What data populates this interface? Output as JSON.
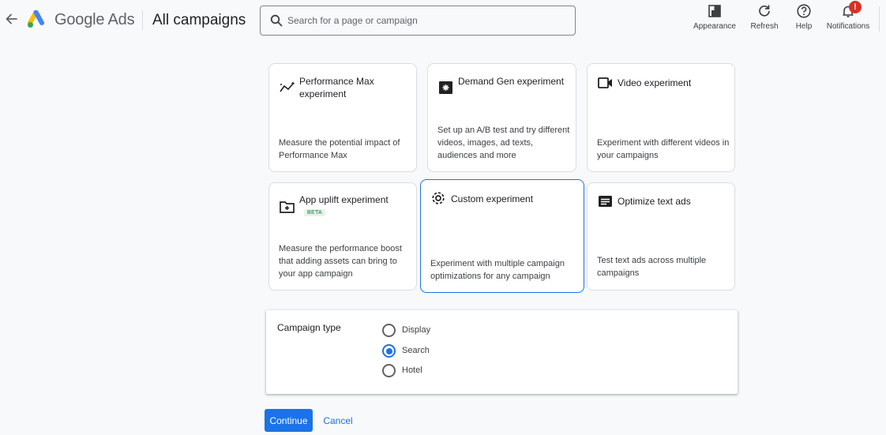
{
  "header": {
    "brand": "Google Ads",
    "title": "All campaigns",
    "search_placeholder": "Search for a page or campaign",
    "actions": [
      {
        "label": "Appearance",
        "icon": "appearance-icon"
      },
      {
        "label": "Refresh",
        "icon": "refresh-icon"
      },
      {
        "label": "Help",
        "icon": "help-icon"
      },
      {
        "label": "Notifications",
        "icon": "bell-icon",
        "badge": "!"
      }
    ]
  },
  "cards": [
    {
      "title": "Performance Max experiment",
      "description": "Measure the potential impact of Performance Max",
      "icon": "pmax-icon"
    },
    {
      "title": "Demand Gen experiment",
      "description": "Set up an A/B test and try different videos, images, ad texts, audiences and more",
      "icon": "demand-gen-icon"
    },
    {
      "title": "Video experiment",
      "description": "Experiment with different videos in your campaigns",
      "icon": "video-icon"
    },
    {
      "title": "App uplift experiment",
      "badge": "BETA",
      "description": "Measure the performance boost that adding assets can bring to your app campaign",
      "icon": "app-folder-icon"
    },
    {
      "title": "Custom experiment",
      "description": "Experiment with multiple campaign optimizations for any campaign",
      "icon": "gear-icon",
      "selected": true
    },
    {
      "title": "Optimize text ads",
      "description": "Test text ads across multiple campaigns",
      "icon": "text-ad-icon"
    }
  ],
  "campaign_type": {
    "label": "Campaign type",
    "options": [
      "Display",
      "Search",
      "Hotel"
    ],
    "selected": "Search"
  },
  "buttons": {
    "continue": "Continue",
    "cancel": "Cancel"
  },
  "colors": {
    "accent": "#1a73e8",
    "badge_red": "#d93025",
    "beta_bg": "#e6f4ea",
    "beta_text": "#137333"
  }
}
